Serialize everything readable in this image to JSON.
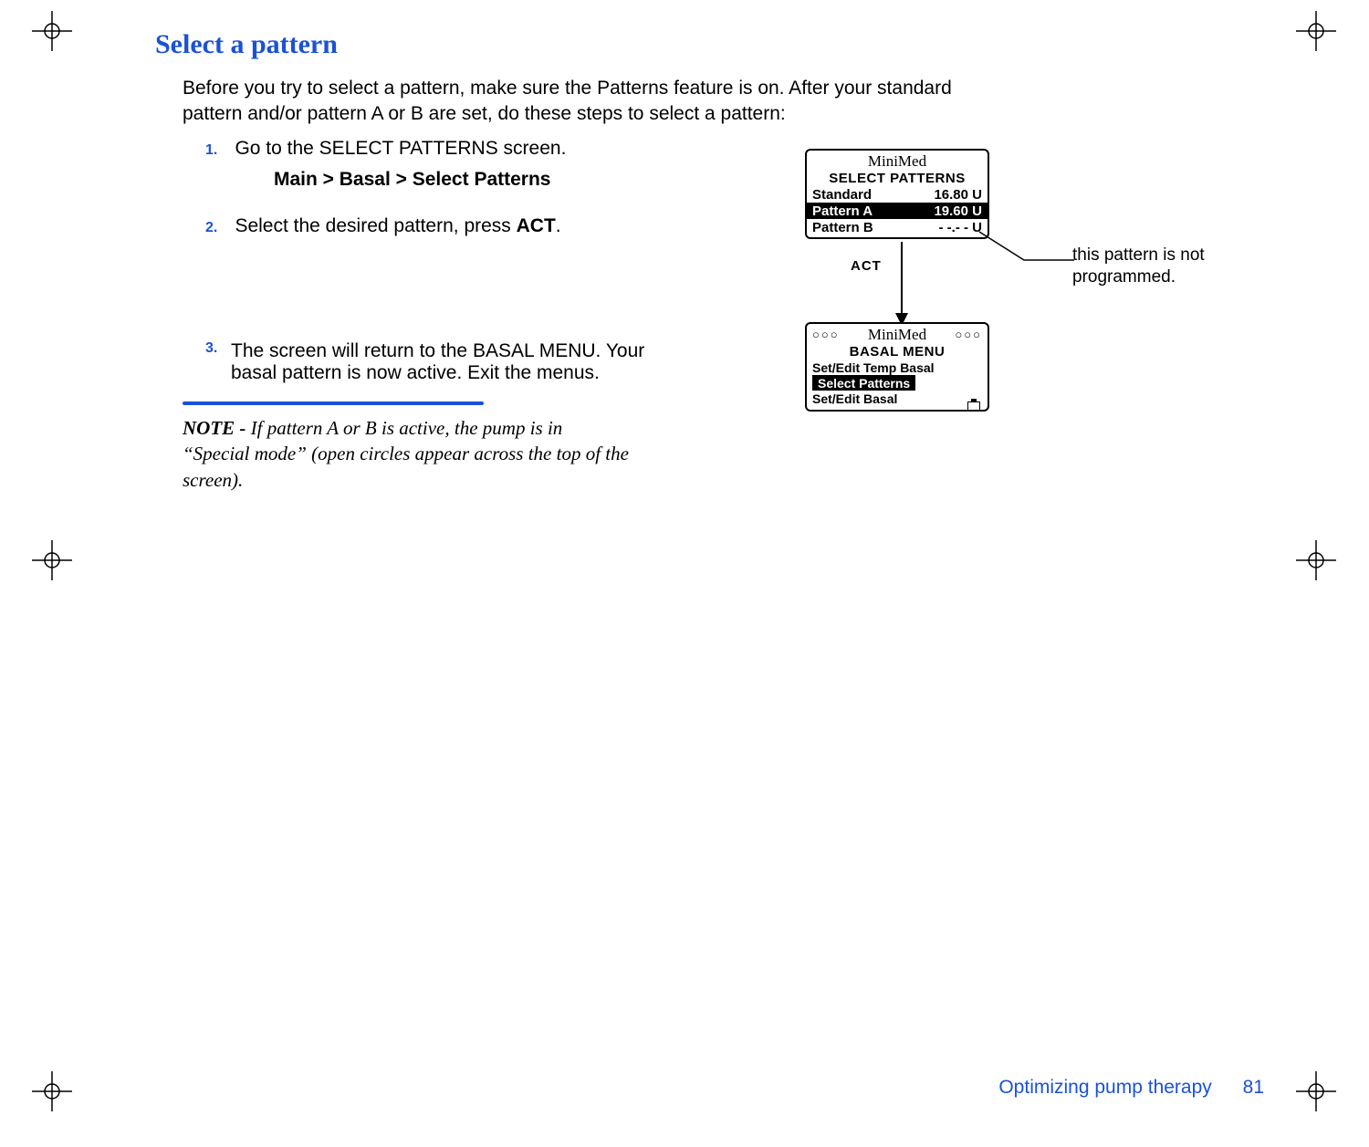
{
  "heading": "Select a pattern",
  "intro": "Before you try to select a pattern, make sure the Patterns feature is on. After your standard pattern and/or pattern A or B are set, do these steps to select a pattern:",
  "steps": {
    "s1_num": "1.",
    "s1_text": "Go to the SELECT PATTERNS screen.",
    "nav_path": "Main > Basal > Select Patterns",
    "s2_num": "2.",
    "s2_text_a": "Select the desired pattern, press ",
    "s2_text_b": "ACT",
    "s2_text_c": ".",
    "s3_num": "3.",
    "s3_text": "The screen will return to the BASAL MENU. Your basal pattern is now active. Exit the menus."
  },
  "note": {
    "label": "NOTE - ",
    "text": "If pattern A or B is active, the pump is in “Special mode” (open circles appear across the top of the screen)."
  },
  "footer": {
    "section": "Optimizing pump therapy",
    "page": "81"
  },
  "screen1": {
    "brand": "MiniMed",
    "title": "SELECT PATTERNS",
    "rows": [
      {
        "label": "Standard",
        "value": "16.80 U",
        "selected": false
      },
      {
        "label": "Pattern A",
        "value": "19.60 U",
        "selected": true
      },
      {
        "label": "Pattern B",
        "value": "- -.- - U",
        "selected": false
      }
    ]
  },
  "act_label": "ACT",
  "callout": "this pattern is not programmed.",
  "screen2": {
    "brand": "MiniMed",
    "circles_left": "○○○",
    "circles_right": "○○○",
    "title": "BASAL MENU",
    "items": [
      {
        "label": "Set/Edit Temp Basal",
        "selected": false
      },
      {
        "label": "Select Patterns",
        "selected": true
      },
      {
        "label": "Set/Edit Basal",
        "selected": false
      }
    ]
  }
}
